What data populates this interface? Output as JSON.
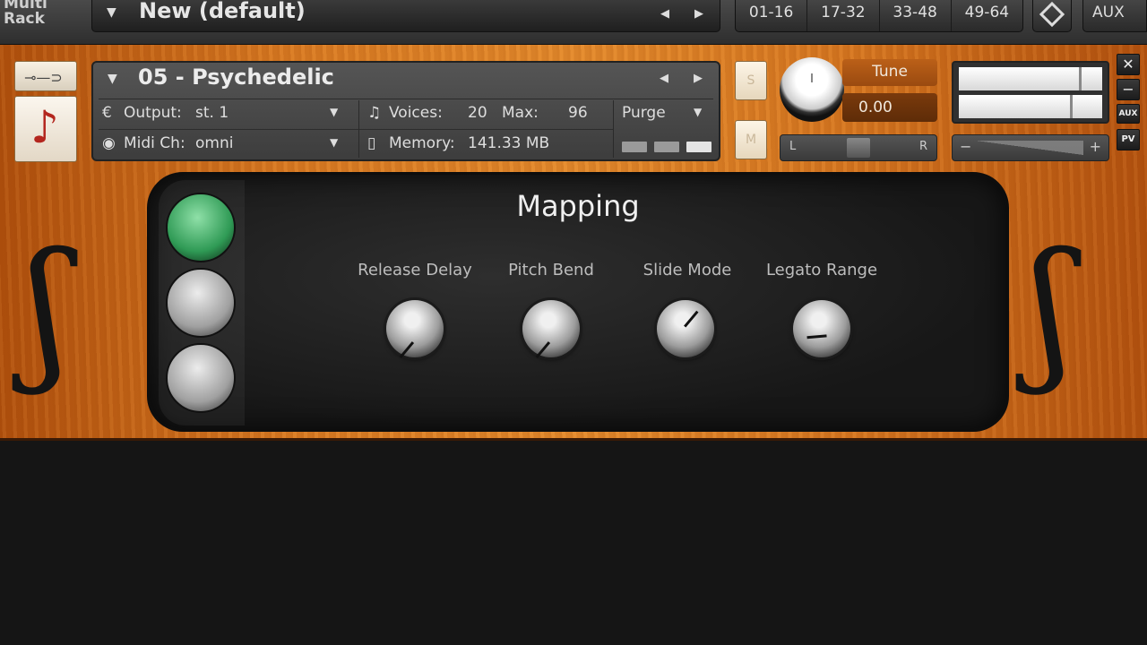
{
  "rack": {
    "label": "Multi\nRack",
    "preset_name": "New (default)",
    "page_tabs": [
      "01-16",
      "17-32",
      "33-48",
      "49-64"
    ],
    "aux_label": "AUX"
  },
  "instrument": {
    "name": "05 - Psychedelic",
    "output_label": "Output:",
    "output_value": "st. 1",
    "midi_label": "Midi Ch:",
    "midi_value": "omni",
    "voices_label": "Voices:",
    "voices_value": "20",
    "max_label": "Max:",
    "max_value": "96",
    "purge_label": "Purge",
    "memory_label": "Memory:",
    "memory_value": "141.33 MB",
    "solo_label": "S",
    "mute_label": "M",
    "tune_label": "Tune",
    "tune_value": "0.00",
    "pan_left": "L",
    "pan_right": "R",
    "vol_minus": "−",
    "vol_plus": "+",
    "close_label": "✕",
    "minimize_label": "−",
    "aux_small_label": "AUX",
    "pv_label": "PV"
  },
  "panel": {
    "title": "Mapping",
    "knobs": [
      {
        "label": "Release Delay"
      },
      {
        "label": "Pitch Bend"
      },
      {
        "label": "Slide Mode"
      },
      {
        "label": "Legato Range"
      }
    ]
  },
  "colors": {
    "wood": "#d97a22",
    "panel": "#1c1c1c",
    "active_side_button": "#2f9a55"
  }
}
